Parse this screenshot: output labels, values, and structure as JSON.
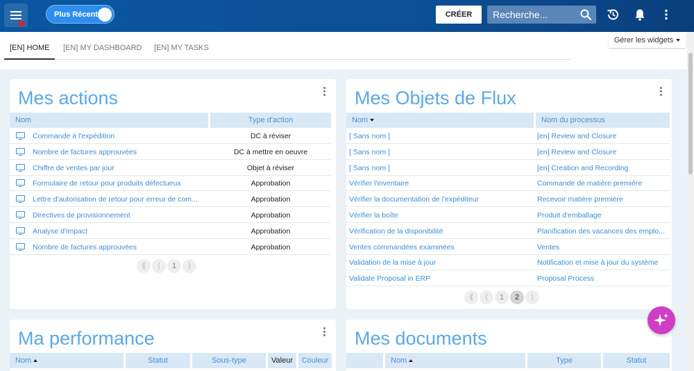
{
  "topbar": {
    "toggle_label": "Plus Récent",
    "create_label": "CRÉER",
    "search_placeholder": "Recherche...",
    "icons": [
      "menu-icon",
      "search-icon",
      "history-icon",
      "bell-icon",
      "more-vertical-icon"
    ]
  },
  "tabs": [
    {
      "label": "[EN] HOME",
      "active": true
    },
    {
      "label": "[EN] MY DASHBOARD",
      "active": false
    },
    {
      "label": "[EN] MY TASKS",
      "active": false
    }
  ],
  "widgets_button": "Gérer les widgets",
  "mes_actions": {
    "title": "Mes actions",
    "columns": [
      "Nom",
      "Type d'action"
    ],
    "rows": [
      {
        "name": "Commande à l'expédition",
        "type": "DC à réviser"
      },
      {
        "name": "Nombre de factures approuvées",
        "type": "DC à mettre en oeuvre"
      },
      {
        "name": "Chiffre de ventes par jour",
        "type": "Objet à réviser"
      },
      {
        "name": "Formulaire de retour pour produits défectueux",
        "type": "Approbation"
      },
      {
        "name": "Lettre d'autorisation de retour pour erreur de com...",
        "type": "Approbation"
      },
      {
        "name": "Directives de provisionnement",
        "type": "Approbation"
      },
      {
        "name": "Analyse d'impact",
        "type": "Approbation"
      },
      {
        "name": "Nombre de factures approuvées",
        "type": "Approbation"
      }
    ],
    "pager": {
      "first": "⟪",
      "prev": "⟨",
      "pages": [
        "1"
      ],
      "next": "⟩",
      "current": "1"
    }
  },
  "mes_objets": {
    "title": "Mes Objets de Flux",
    "columns": [
      "Nom",
      "Nom du processus"
    ],
    "rows": [
      {
        "name": "[ Sans nom ]",
        "process": "[en] Review and Closure"
      },
      {
        "name": "[ Sans nom ]",
        "process": "[en] Review and Closure"
      },
      {
        "name": "[ Sans nom ]",
        "process": "[en] Creation and Recording"
      },
      {
        "name": "Vérifier l'inventaire",
        "process": "Commande de matière première"
      },
      {
        "name": "Vérifier la documentation de l'expéditeur",
        "process": "Recevoir matière première"
      },
      {
        "name": "Vérifier la boîte",
        "process": "Produit d'emballage"
      },
      {
        "name": "Vérification de la disponibilité",
        "process": "Planification des vacances des emplo..."
      },
      {
        "name": "Ventes commandées examinées",
        "process": "Ventes"
      },
      {
        "name": "Validation de la mise à jour",
        "process": "Notification et mise à jour du système"
      },
      {
        "name": "Validate Proposal in ERP",
        "process": "Proposal Process"
      }
    ],
    "pager": {
      "first": "⟪",
      "prev": "⟨",
      "pages": [
        "1",
        "2"
      ],
      "next": "⟩",
      "current": "2"
    }
  },
  "ma_performance": {
    "title": "Ma performance",
    "columns": [
      "Nom",
      "Statut",
      "Sous-type",
      "Valeur",
      "Couleur"
    ]
  },
  "mes_documents": {
    "title": "Mes documents",
    "columns": [
      "",
      "Nom",
      "Type",
      "Statut"
    ]
  },
  "colors": {
    "topbar": "#0c4f95",
    "accent": "#5aa8e6",
    "link": "#3a8fd6",
    "header_bg": "#d9e8f6",
    "fab": "#d03cc2"
  }
}
